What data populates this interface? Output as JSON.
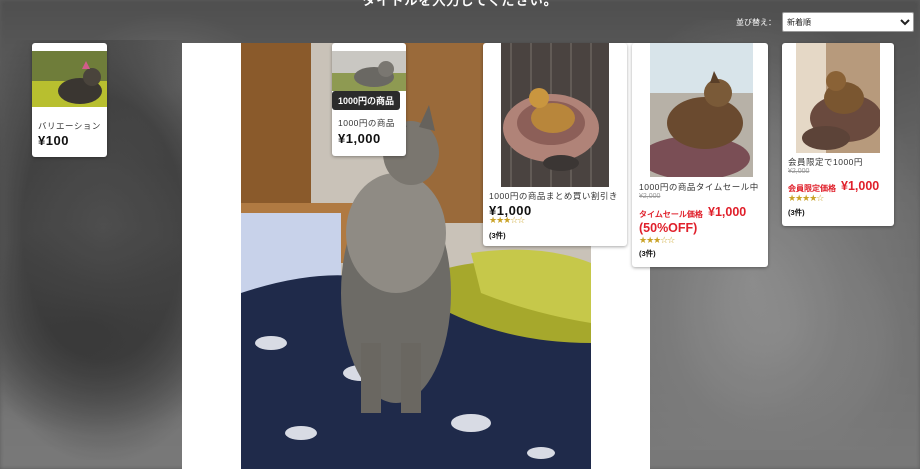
{
  "page": {
    "heading": "タイトルを入力してください。"
  },
  "sort": {
    "label": "並び替え：",
    "selected": "新着順"
  },
  "tooltip": {
    "text": "1000円の商品"
  },
  "products": [
    {
      "name": "バリエーション",
      "price": "¥100"
    },
    {
      "name": "1000円の商品",
      "price": "¥1,000"
    },
    {
      "name": "1000円の商品まとめ買い割引き",
      "price": "¥1,000",
      "rating": "★★★☆☆",
      "count": "(3件)"
    },
    {
      "name": "1000円の商品タイムセール中",
      "old_price": "¥2,000",
      "sale_label": "タイムセール価格",
      "sale_price": "¥1,000",
      "discount": "(50%OFF)",
      "rating": "★★★☆☆",
      "count": "(3件)"
    },
    {
      "name": "会員限定で1000円",
      "old_price": "¥2,000",
      "sale_label": "会員限定価格",
      "sale_price": "¥1,000",
      "rating": "★★★★☆",
      "count": "(3件)"
    }
  ]
}
